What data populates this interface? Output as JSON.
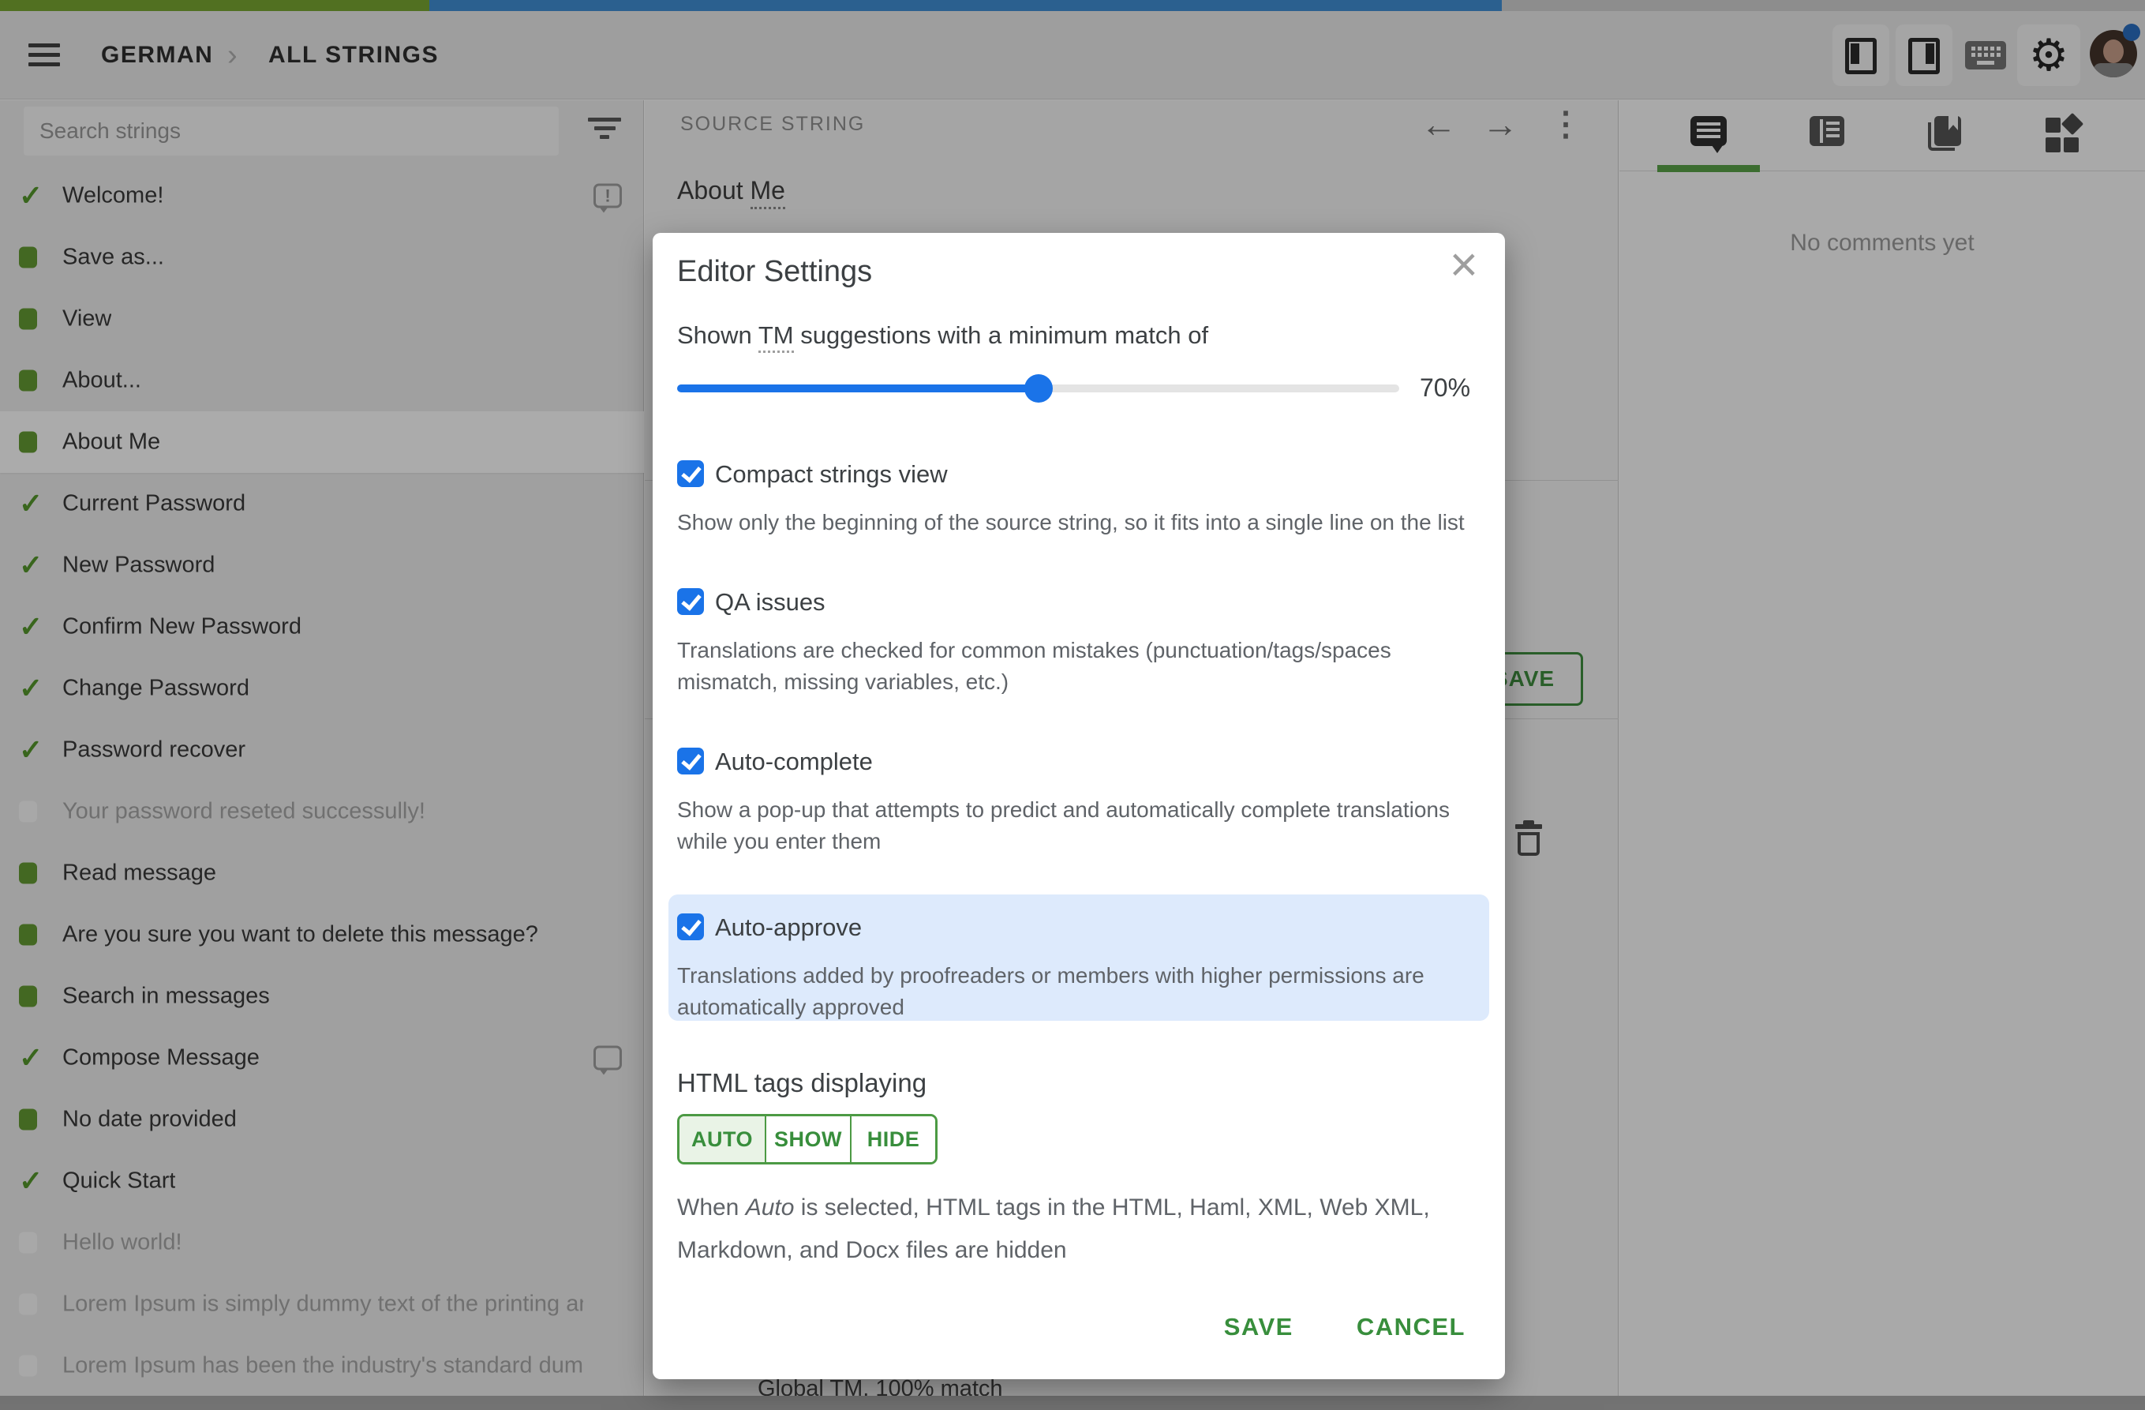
{
  "colors": {
    "progress_green": "#79a832",
    "progress_blue": "#4190d6",
    "accent_green": "#388e3c",
    "accent_blue": "#1a73e8",
    "highlight_blue": "#ddeafc",
    "translated_green": "#649b34"
  },
  "topbar": {
    "breadcrumb": {
      "project": "GERMAN",
      "section": "ALL STRINGS",
      "separator": "›"
    }
  },
  "sidebar": {
    "search_placeholder": "Search strings",
    "items": [
      {
        "label": "Welcome!",
        "status": "approved",
        "badge": "issue",
        "selected": false
      },
      {
        "label": "Save as...",
        "status": "translated",
        "badge": "",
        "selected": false
      },
      {
        "label": "View",
        "status": "translated",
        "badge": "",
        "selected": false
      },
      {
        "label": "About...",
        "status": "translated",
        "badge": "",
        "selected": false
      },
      {
        "label": "About Me",
        "status": "translated",
        "badge": "",
        "selected": true
      },
      {
        "label": "Current Password",
        "status": "approved",
        "badge": "",
        "selected": false
      },
      {
        "label": "New Password",
        "status": "approved",
        "badge": "",
        "selected": false
      },
      {
        "label": "Confirm New Password",
        "status": "approved",
        "badge": "",
        "selected": false
      },
      {
        "label": "Change Password",
        "status": "approved",
        "badge": "",
        "selected": false
      },
      {
        "label": "Password recover",
        "status": "approved",
        "badge": "",
        "selected": false
      },
      {
        "label": "Your password reseted successully!",
        "status": "untranslated",
        "badge": "",
        "selected": false
      },
      {
        "label": "Read message",
        "status": "translated",
        "badge": "",
        "selected": false
      },
      {
        "label": "Are you sure you want to delete this message?",
        "status": "translated",
        "badge": "",
        "selected": false
      },
      {
        "label": "Search in messages",
        "status": "translated",
        "badge": "",
        "selected": false
      },
      {
        "label": "Compose Message",
        "status": "approved",
        "badge": "comment",
        "selected": false
      },
      {
        "label": "No date provided",
        "status": "translated",
        "badge": "",
        "selected": false
      },
      {
        "label": "Quick Start",
        "status": "approved",
        "badge": "",
        "selected": false
      },
      {
        "label": "Hello world!",
        "status": "untranslated",
        "badge": "",
        "selected": false
      },
      {
        "label": "Lorem Ipsum is simply dummy text of the printing and ty…",
        "status": "untranslated",
        "badge": "",
        "selected": false
      },
      {
        "label": "Lorem Ipsum has been the industry's standard dummy t…",
        "status": "untranslated",
        "badge": "",
        "selected": false
      }
    ]
  },
  "source": {
    "label": "SOURCE STRING",
    "text_pre": "About ",
    "text_term": "Me",
    "prev_icon": "←",
    "next_icon": "→",
    "more_icon": "⋮"
  },
  "editor": {
    "save_label": "SAVE",
    "tm_suggestion": "Global TM, 100% match"
  },
  "comments_panel": {
    "empty_text": "No comments yet"
  },
  "modal": {
    "title": "Editor Settings",
    "close_icon": "×",
    "tm_label_pre": "Shown ",
    "tm_label_term": "TM",
    "tm_label_post": " suggestions with a minimum match of",
    "slider": {
      "value": "70%",
      "fill_pct": 50
    },
    "settings": {
      "compact": {
        "label": "Compact strings view",
        "checked": true,
        "desc": "Show only the beginning of the source string, so it fits into a single line on the list"
      },
      "qa": {
        "label": "QA issues",
        "checked": true,
        "desc": "Translations are checked for common mistakes (punctuation/tags/spaces mismatch, missing variables, etc.)"
      },
      "autocomplete": {
        "label": "Auto-complete",
        "checked": true,
        "desc": "Show a pop-up that attempts to predict and automatically complete translations while you enter them"
      },
      "autoapprove": {
        "label": "Auto-approve",
        "checked": true,
        "highlighted": true,
        "desc": "Translations added by proofreaders or members with higher permissions are automatically approved"
      }
    },
    "html_tags": {
      "label": "HTML tags displaying",
      "options": [
        "AUTO",
        "SHOW",
        "HIDE"
      ],
      "selected": "AUTO",
      "desc_pre": "When ",
      "desc_it": "Auto",
      "desc_post": " is selected, HTML tags in the HTML, Haml, XML, Web XML, Markdown, and Docx files are hidden"
    },
    "save_label": "SAVE",
    "cancel_label": "CANCEL"
  }
}
